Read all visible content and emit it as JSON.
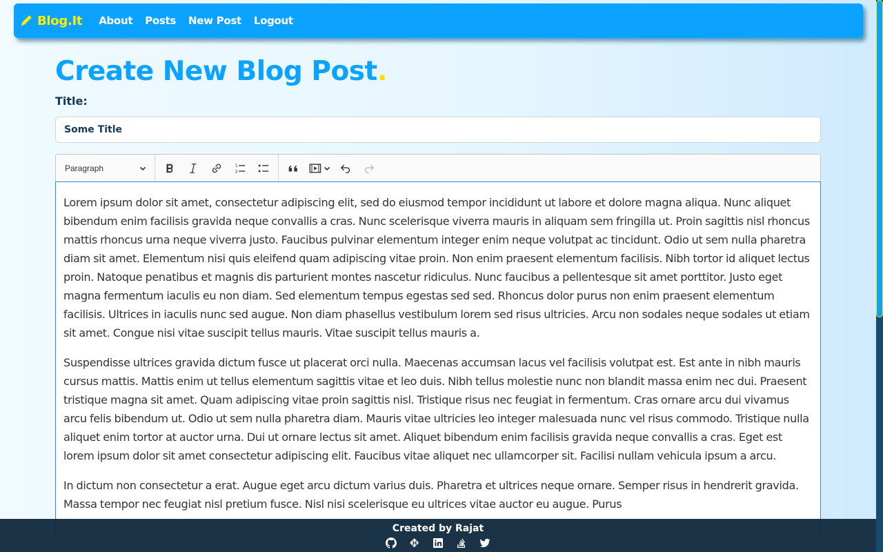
{
  "navbar": {
    "brand": "Blog.It",
    "brand_icon": "pen-icon",
    "links": [
      {
        "label": "About"
      },
      {
        "label": "Posts"
      },
      {
        "label": "New Post"
      },
      {
        "label": "Logout"
      }
    ]
  },
  "page": {
    "title": "Create New Blog Post",
    "title_dot": "."
  },
  "form": {
    "title_label": "Title:",
    "title_value": "Some Title"
  },
  "editor": {
    "heading_select": "Paragraph",
    "toolbar": [
      {
        "name": "bold",
        "icon": "bold-icon"
      },
      {
        "name": "italic",
        "icon": "italic-icon"
      },
      {
        "name": "link",
        "icon": "link-icon"
      },
      {
        "name": "numbered-list",
        "icon": "numbered-list-icon"
      },
      {
        "name": "bulleted-list",
        "icon": "bulleted-list-icon"
      },
      {
        "name": "block-quote",
        "icon": "quote-icon"
      },
      {
        "name": "insert-media",
        "icon": "media-icon"
      },
      {
        "name": "undo",
        "icon": "undo-icon"
      },
      {
        "name": "redo",
        "icon": "redo-icon",
        "disabled": true
      }
    ],
    "paragraphs": [
      "Lorem ipsum dolor sit amet, consectetur adipiscing elit, sed do eiusmod tempor incididunt ut labore et dolore magna aliqua. Nunc aliquet bibendum enim facilisis gravida neque convallis a cras. Nunc scelerisque viverra mauris in aliquam sem fringilla ut. Proin sagittis nisl rhoncus mattis rhoncus urna neque viverra justo. Faucibus pulvinar elementum integer enim neque volutpat ac tincidunt. Odio ut sem nulla pharetra diam sit amet. Elementum nisi quis eleifend quam adipiscing vitae proin. Non enim praesent elementum facilisis. Nibh tortor id aliquet lectus proin. Natoque penatibus et magnis dis parturient montes nascetur ridiculus. Nunc faucibus a pellentesque sit amet porttitor. Justo eget magna fermentum iaculis eu non diam. Sed elementum tempus egestas sed sed. Rhoncus dolor purus non enim praesent elementum facilisis. Ultrices in iaculis nunc sed augue. Non diam phasellus vestibulum lorem sed risus ultricies. Arcu non sodales neque sodales ut etiam sit amet. Congue nisi vitae suscipit tellus mauris. Vitae suscipit tellus mauris a.",
      "Suspendisse ultrices gravida dictum fusce ut placerat orci nulla. Maecenas accumsan lacus vel facilisis volutpat est. Est ante in nibh mauris cursus mattis. Mattis enim ut tellus elementum sagittis vitae et leo duis. Nibh tellus molestie nunc non blandit massa enim nec dui. Praesent tristique magna sit amet. Quam adipiscing vitae proin sagittis nisl. Tristique risus nec feugiat in fermentum. Cras ornare arcu dui vivamus arcu felis bibendum ut. Odio ut sem nulla pharetra diam. Mauris vitae ultricies leo integer malesuada nunc vel risus commodo. Tristique nulla aliquet enim tortor at auctor urna. Dui ut ornare lectus sit amet. Aliquet bibendum enim facilisis gravida neque convallis a cras. Eget est lorem ipsum dolor sit amet consectetur adipiscing elit. Faucibus vitae aliquet nec ullamcorper sit. Facilisi nullam vehicula ipsum a arcu.",
      "In dictum non consectetur a erat. Augue eget arcu dictum varius duis. Pharetra et ultrices neque ornare. Semper risus in hendrerit gravida. Massa tempor nec feugiat nisl pretium fusce. Nisl nisi scelerisque eu ultrices vitae auctor eu augue. Purus"
    ]
  },
  "footer": {
    "credit": "Created by Rajat",
    "icons": [
      "github-icon",
      "hashnode-icon",
      "linkedin-icon",
      "stackoverflow-icon",
      "twitter-icon"
    ]
  },
  "colors": {
    "primary": "#0ca2ff",
    "accent": "#ffee00",
    "heading_text": "#163a55",
    "footer_bg": "#142c40",
    "editor_focus_border": "#2b85dc"
  }
}
